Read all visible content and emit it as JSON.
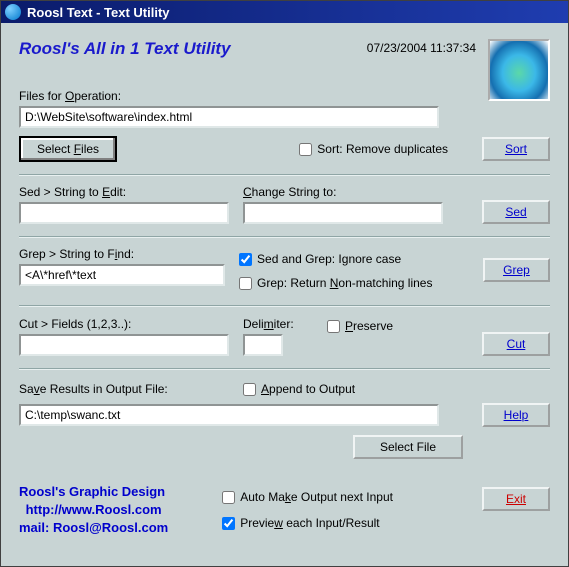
{
  "window": {
    "title": "Roosl Text - Text Utility"
  },
  "header": {
    "app_title": "Roosl's All in 1 Text Utility",
    "timestamp": "07/23/2004 11:37:34"
  },
  "files": {
    "label_pre": "Files for ",
    "label_u": "O",
    "label_post": "peration:",
    "value": "D:\\WebSite\\software\\index.html",
    "select_label_pre": "Select ",
    "select_label_u": "F",
    "select_label_post": "iles",
    "sort_cb": "Sort: Remove duplicates",
    "sort_btn_u": "S",
    "sort_btn_post": "ort"
  },
  "sed": {
    "edit_label_pre": "Sed > String to ",
    "edit_label_u": "E",
    "edit_label_post": "dit:",
    "edit_value": "",
    "change_label_u": "C",
    "change_label_post": "hange String to:",
    "change_value": "",
    "btn_pre": "Se",
    "btn_u": "d"
  },
  "grep": {
    "find_label_pre": "Grep > String to F",
    "find_label_u": "i",
    "find_label_post": "nd:",
    "find_value": "<A\\*href\\*text",
    "ignore_label": "Sed and Grep: Ignore case",
    "nonmatch_label_pre": "Grep: Return ",
    "nonmatch_label_u": "N",
    "nonmatch_label_post": "on-matching lines",
    "btn_u": "G",
    "btn_post": "rep"
  },
  "cut": {
    "fields_label": "Cut > Fields (1,2,3..):",
    "fields_value": "",
    "delim_label_pre": "Deli",
    "delim_label_u": "m",
    "delim_label_post": "iter:",
    "delim_value": "",
    "preserve_u": "P",
    "preserve_post": "reserve",
    "btn_pre": "C",
    "btn_u": "u",
    "btn_post": "t"
  },
  "output": {
    "save_label_pre": "Sa",
    "save_label_u": "v",
    "save_label_post": "e Results in Output File:",
    "append_u": "A",
    "append_post": "ppend to Output",
    "value": "C:\\temp\\swanc.txt",
    "select_label": "Select File",
    "help_u": "H",
    "help_post": "elp"
  },
  "footer": {
    "line1": "Roosl's Graphic Design",
    "line2": "http://www.Roosl.com",
    "line3": "mail: Roosl@Roosl.com",
    "automake_pre": "Auto Ma",
    "automake_u": "k",
    "automake_post": "e Output next Input",
    "preview_pre": "Previe",
    "preview_u": "w",
    "preview_post": " each Input/Result",
    "exit_pre": "E",
    "exit_u": "x",
    "exit_post": "it"
  }
}
